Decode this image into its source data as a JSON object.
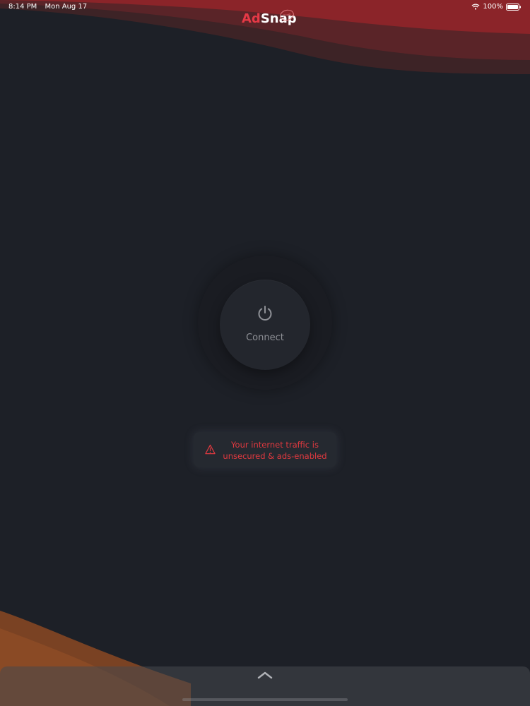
{
  "status_bar": {
    "time": "8:14 PM",
    "date": "Mon Aug 17",
    "battery": "100%",
    "wifi_icon": "wifi-icon",
    "battery_icon": "battery-icon"
  },
  "app": {
    "logo_part1": "Ad",
    "logo_part2": "Snap",
    "logo_badge": "Free"
  },
  "connect": {
    "label": "Connect",
    "icon": "power-icon"
  },
  "warning": {
    "icon": "warning-icon",
    "line1": "Your internet traffic is",
    "line2": "unsecured & ads-enabled"
  },
  "bottom_sheet": {
    "icon": "chevron-up-icon"
  },
  "colors": {
    "background": "#1d2027",
    "accent_red": "#e63946",
    "warning_text": "#e0393f",
    "wave_top": "#8b2429",
    "wave_bottom": "#8a4a25"
  }
}
